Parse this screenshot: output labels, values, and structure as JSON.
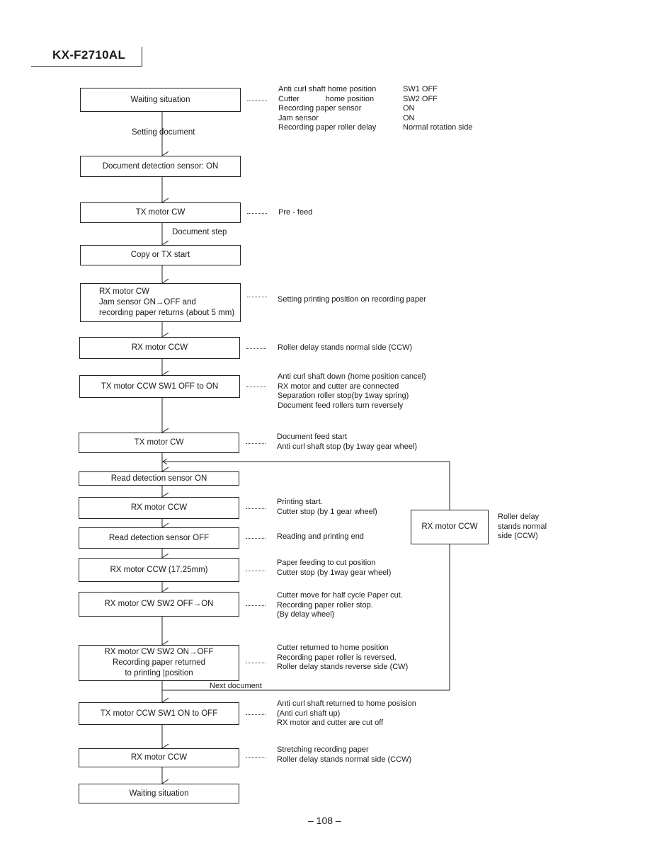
{
  "header": {
    "model": "KX-F2710AL"
  },
  "page_number": "– 108 –",
  "flow": {
    "boxes": [
      {
        "id": "waiting-1",
        "lines": [
          "Waiting situation"
        ]
      },
      {
        "id": "doc-detect",
        "lines": [
          "Document detection sensor: ON"
        ]
      },
      {
        "id": "tx-cw-1",
        "lines": [
          "TX motor CW"
        ]
      },
      {
        "id": "copy-tx-start",
        "lines": [
          "Copy or TX start"
        ]
      },
      {
        "id": "rx-cw-jam",
        "lines": [
          "RX motor CW",
          "Jam sensor ON→OFF and",
          "recording paper returns (about 5 mm)"
        ]
      },
      {
        "id": "rx-ccw-1",
        "lines": [
          "RX motor CCW"
        ]
      },
      {
        "id": "tx-ccw-sw1-on",
        "lines": [
          "TX motor CCW SW1 OFF to ON"
        ]
      },
      {
        "id": "tx-cw-2",
        "lines": [
          "TX motor CW"
        ]
      },
      {
        "id": "read-on",
        "lines": [
          "Read detection sensor ON"
        ]
      },
      {
        "id": "rx-ccw-2",
        "lines": [
          "RX motor CCW"
        ]
      },
      {
        "id": "read-off",
        "lines": [
          "Read detection sensor  OFF"
        ]
      },
      {
        "id": "rx-ccw-1725",
        "lines": [
          "RX motor CCW (17.25mm)"
        ]
      },
      {
        "id": "rx-cw-sw2-on",
        "lines": [
          "RX motor CW SW2 OFF→ON"
        ]
      },
      {
        "id": "rx-cw-sw2-off",
        "lines": [
          "RX motor CW SW2 ON→OFF",
          "Recording paper returned",
          "to printing |position"
        ]
      },
      {
        "id": "tx-ccw-sw1-off",
        "lines": [
          "TX motor CCW SW1 ON to OFF"
        ]
      },
      {
        "id": "rx-ccw-3",
        "lines": [
          "RX motor CCW"
        ]
      },
      {
        "id": "waiting-2",
        "lines": [
          "Waiting situation"
        ]
      },
      {
        "id": "loop-rx-ccw",
        "lines": [
          "RX motor CCW"
        ]
      }
    ],
    "edge_labels": {
      "setting_document": "Setting document",
      "document_step": "Document step",
      "next_document": "Next document"
    },
    "initial_state": [
      {
        "item": "Anti curl shaft home position",
        "value": "SW1 OFF"
      },
      {
        "item": "Cutter            home position",
        "value": "SW2 OFF"
      },
      {
        "item": "Recording paper sensor",
        "value": "ON"
      },
      {
        "item": "Jam sensor",
        "value": "ON"
      },
      {
        "item": "Recording paper roller delay",
        "value": "Normal rotation side"
      }
    ],
    "notes": {
      "tx-cw-1": [
        "Pre - feed"
      ],
      "rx-cw-jam": [
        "Setting printing position  on recording paper"
      ],
      "rx-ccw-1": [
        "Roller delay stands normal side (CCW)"
      ],
      "tx-ccw-sw1-on": [
        "Anti curl shaft down (home position  cancel)",
        "RX motor and cutter are connected",
        "Separation roller stop(by 1way spring)",
        "Document feed rollers turn reversely"
      ],
      "tx-cw-2": [
        "Document feed start",
        "Anti curl shaft stop (by 1way gear wheel)"
      ],
      "rx-ccw-2": [
        "Printing start.",
        "Cutter stop (by 1 gear wheel)"
      ],
      "read-off": [
        "Reading and printing end"
      ],
      "rx-ccw-1725": [
        "Paper feeding to cut position",
        "Cutter stop (by 1way gear wheel)"
      ],
      "rx-cw-sw2-on": [
        "Cutter move for half cycle Paper cut.",
        "Recording paper roller stop.",
        "(By delay wheel)"
      ],
      "rx-cw-sw2-off": [
        "Cutter returned to home position",
        "Recording paper roller is reversed.",
        "Roller delay stands reverse side (CW)"
      ],
      "tx-ccw-sw1-off": [
        "Anti curl shaft returned to home posision",
        "(Anti curl shaft up)",
        "RX motor and cutter are cut off"
      ],
      "rx-ccw-3": [
        "Stretching recording paper",
        "Roller delay stands normal side (CCW)"
      ],
      "loop-rx-ccw": [
        "Roller delay",
        "stands normal",
        "side (CCW)"
      ]
    }
  }
}
